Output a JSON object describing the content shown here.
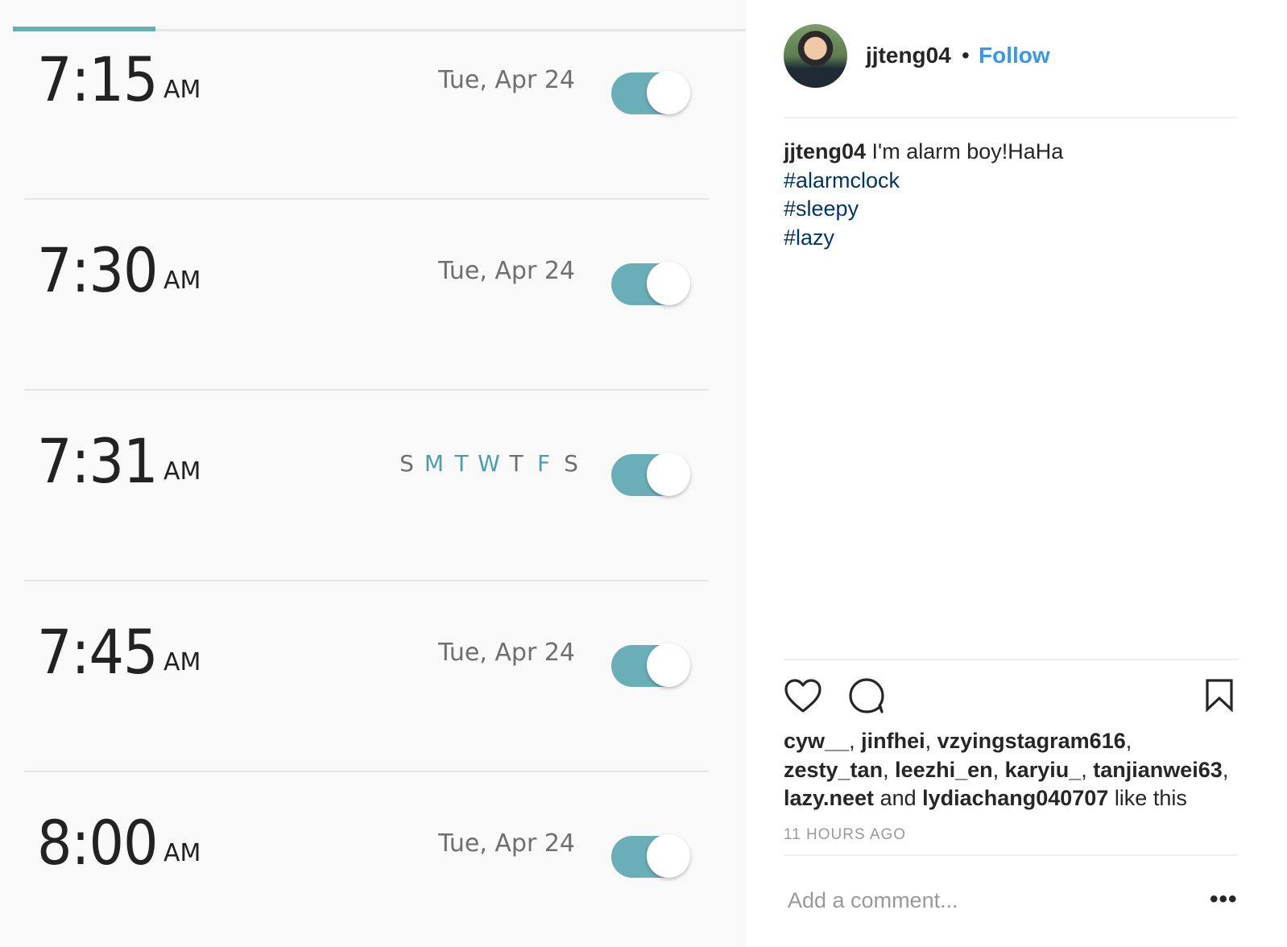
{
  "alarm_app": {
    "colors": {
      "accent": "#6aaeb8",
      "day_on": "#4b9eab",
      "day_off": "#6f6f6f"
    },
    "alarms": [
      {
        "time": "7:15",
        "ampm": "AM",
        "date": "Tue, Apr 24",
        "enabled": true
      },
      {
        "time": "7:30",
        "ampm": "AM",
        "date": "Tue, Apr 24",
        "enabled": true
      },
      {
        "time": "7:31",
        "ampm": "AM",
        "days": [
          "S",
          "M",
          "T",
          "W",
          "T",
          "F",
          "S"
        ],
        "active_days": [
          false,
          true,
          true,
          true,
          false,
          true,
          false
        ],
        "enabled": true
      },
      {
        "time": "7:45",
        "ampm": "AM",
        "date": "Tue, Apr 24",
        "enabled": true
      },
      {
        "time": "8:00",
        "ampm": "AM",
        "date": "Tue, Apr 24",
        "enabled": true
      }
    ]
  },
  "post": {
    "username": "jjteng04",
    "separator": "•",
    "follow_label": "Follow",
    "caption": {
      "user": "jjteng04",
      "text": "I'm alarm boy!HaHa",
      "hashtags": [
        "#alarmclock",
        "#sleepy",
        "#lazy"
      ]
    },
    "likes": {
      "users_line1": [
        "cyw__",
        "jinfhei",
        "vzyingstagram616"
      ],
      "users_line2": [
        "zesty_tan",
        "leezhi_en",
        "karyiu_",
        "tanjianwei63"
      ],
      "users_line3_a": "lazy.neet",
      "and": "and",
      "users_line3_b": "lydiachang040707",
      "suffix": "like this"
    },
    "time_ago": "11 HOURS AGO",
    "comment_placeholder": "Add a comment...",
    "more_label": "•••",
    "colors": {
      "follow": "#3897f0",
      "hashtag": "#003569"
    },
    "icons": {
      "like": "heart-icon",
      "comment": "comment-icon",
      "save": "bookmark-icon"
    }
  }
}
